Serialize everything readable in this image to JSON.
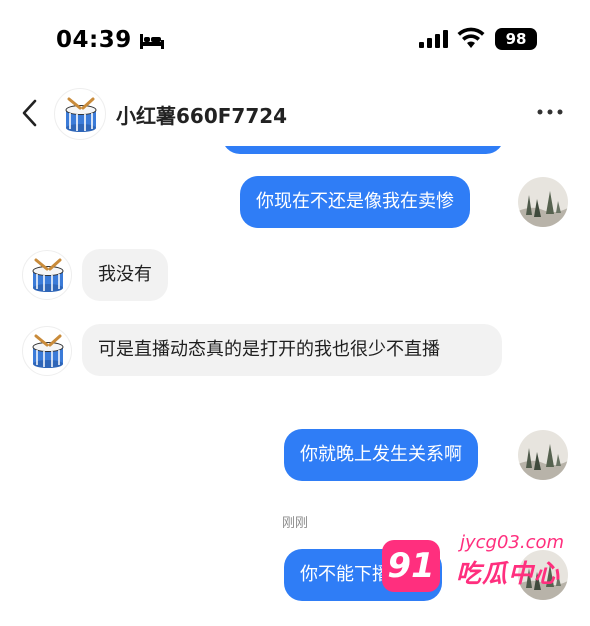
{
  "status_bar": {
    "time": "04:39",
    "sleep_icon": "bed-icon",
    "signal_icon": "cellular-signal-icon",
    "wifi_icon": "wifi-icon",
    "battery": "98"
  },
  "header": {
    "back_icon": "chevron-left-icon",
    "contact_name": "小红薯660F7724",
    "avatar_icon": "drum-icon",
    "more_icon": "more-horizontal-icon"
  },
  "messages": [
    {
      "side": "out",
      "text": "你现在不还是像我在卖惨"
    },
    {
      "side": "in",
      "text": "我没有"
    },
    {
      "side": "in",
      "text": "可是直播动态真的是打开的我也很少不直播"
    },
    {
      "side": "out",
      "text": "你就晚上发生关系啊"
    },
    {
      "side": "out",
      "text": "你不能下播了发"
    }
  ],
  "divider": {
    "text": "刚刚"
  },
  "watermark": {
    "number": "91",
    "domain": "jycg03.com",
    "name": "吃瓜中心"
  },
  "colors": {
    "outgoing_bubble": "#2f7df6",
    "incoming_bubble": "#f2f2f2",
    "watermark": "#ff2f7e"
  }
}
